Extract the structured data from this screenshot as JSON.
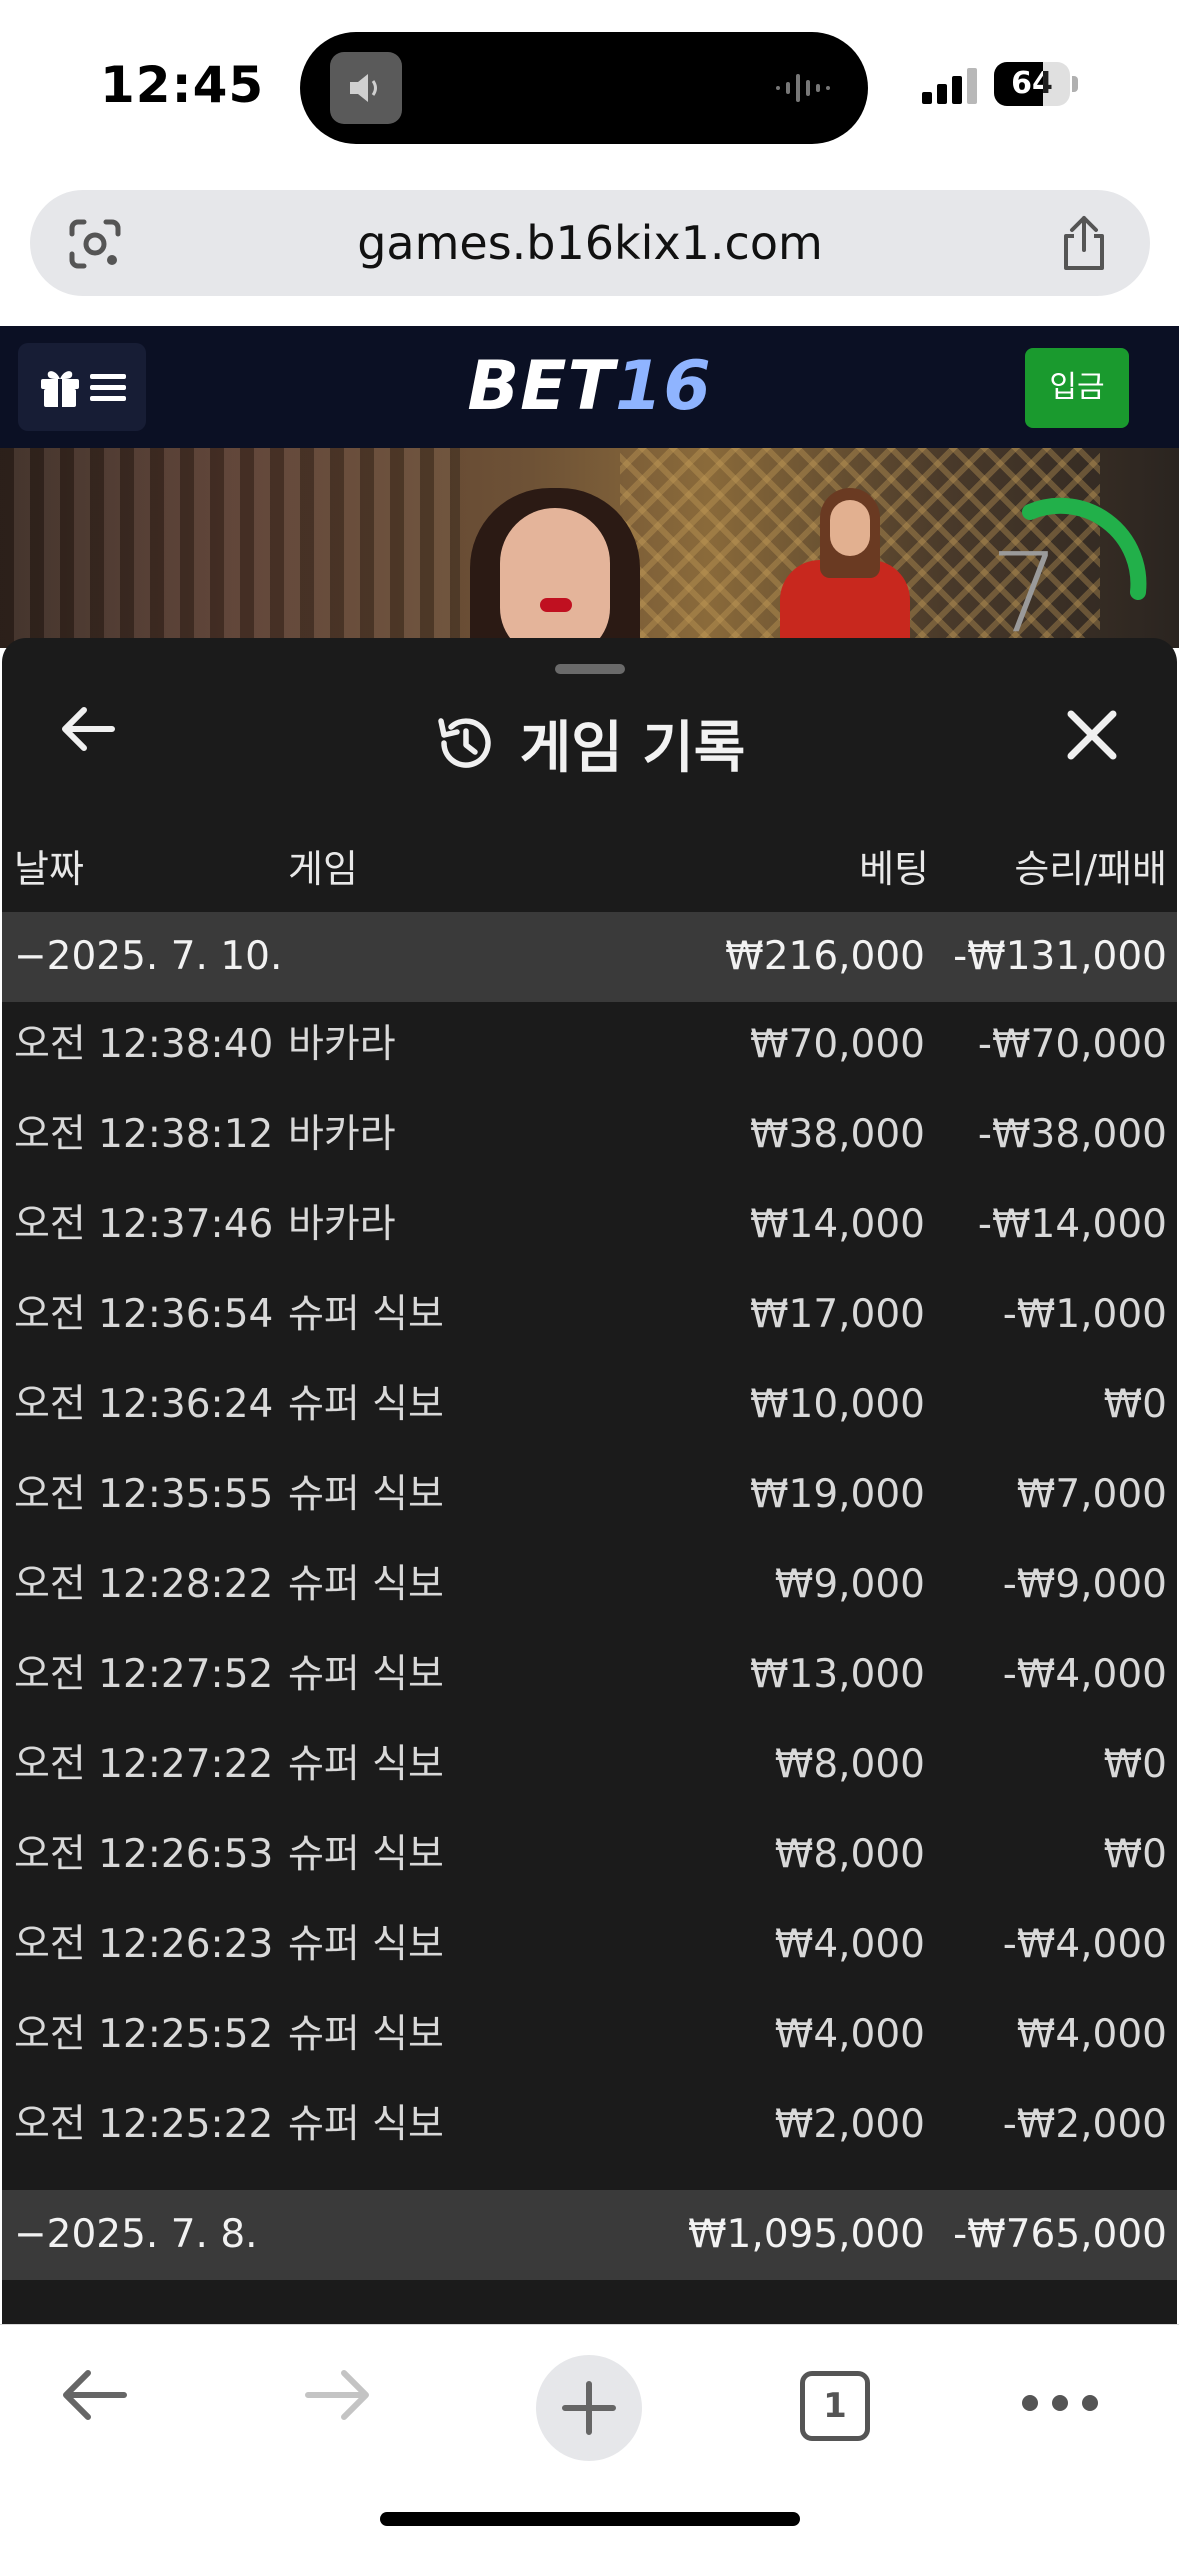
{
  "status_bar": {
    "time": "12:45",
    "battery": "64",
    "battery_level": 0.64
  },
  "browser": {
    "url": "games.b16kix1.com",
    "open_tabs": "1"
  },
  "site": {
    "logo_main": "BET",
    "logo_accent": "16",
    "deposit_label": "입금"
  },
  "video": {
    "timer": "7"
  },
  "sheet": {
    "title": "게임 기록",
    "columns": {
      "date": "날짜",
      "game": "게임",
      "bet": "베팅",
      "win_loss": "승리/패배"
    },
    "groups": [
      {
        "date": "−2025. 7. 10.",
        "bet": "₩216,000",
        "win_loss": "-₩131,000",
        "rows": [
          {
            "time": "오전 12:38:40",
            "game": "바카라",
            "bet": "₩70,000",
            "win_loss": "-₩70,000"
          },
          {
            "time": "오전 12:38:12",
            "game": "바카라",
            "bet": "₩38,000",
            "win_loss": "-₩38,000"
          },
          {
            "time": "오전 12:37:46",
            "game": "바카라",
            "bet": "₩14,000",
            "win_loss": "-₩14,000"
          },
          {
            "time": "오전 12:36:54",
            "game": "슈퍼 식보",
            "bet": "₩17,000",
            "win_loss": "-₩1,000"
          },
          {
            "time": "오전 12:36:24",
            "game": "슈퍼 식보",
            "bet": "₩10,000",
            "win_loss": "₩0"
          },
          {
            "time": "오전 12:35:55",
            "game": "슈퍼 식보",
            "bet": "₩19,000",
            "win_loss": "₩7,000"
          },
          {
            "time": "오전 12:28:22",
            "game": "슈퍼 식보",
            "bet": "₩9,000",
            "win_loss": "-₩9,000"
          },
          {
            "time": "오전 12:27:52",
            "game": "슈퍼 식보",
            "bet": "₩13,000",
            "win_loss": "-₩4,000"
          },
          {
            "time": "오전 12:27:22",
            "game": "슈퍼 식보",
            "bet": "₩8,000",
            "win_loss": "₩0"
          },
          {
            "time": "오전 12:26:53",
            "game": "슈퍼 식보",
            "bet": "₩8,000",
            "win_loss": "₩0"
          },
          {
            "time": "오전 12:26:23",
            "game": "슈퍼 식보",
            "bet": "₩4,000",
            "win_loss": "-₩4,000"
          },
          {
            "time": "오전 12:25:52",
            "game": "슈퍼 식보",
            "bet": "₩4,000",
            "win_loss": "₩4,000"
          },
          {
            "time": "오전 12:25:22",
            "game": "슈퍼 식보",
            "bet": "₩2,000",
            "win_loss": "-₩2,000"
          }
        ]
      },
      {
        "date": "−2025. 7. 8.",
        "bet": "₩1,095,000",
        "win_loss": "-₩765,000",
        "rows": []
      }
    ]
  },
  "colors": {
    "header_bg": "#0b1024",
    "deposit_green": "#1a9a2e",
    "sheet_bg": "#1b1b1b",
    "group_bg": "#3a3a3a",
    "timer_green": "#22b04a"
  }
}
